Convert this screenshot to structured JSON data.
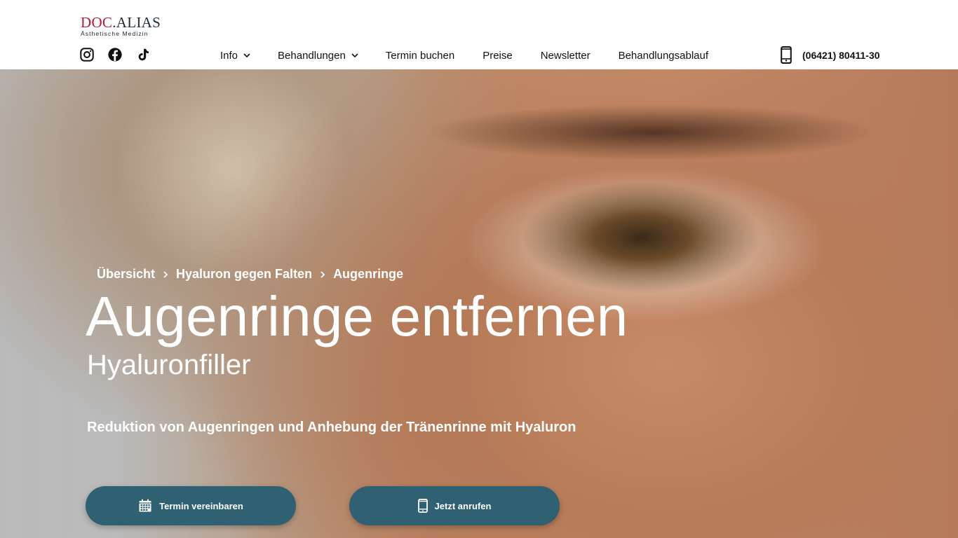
{
  "header": {
    "logo": {
      "brand_doc": "DOC",
      "brand_rest": ".ALIAS",
      "subtitle": "Ästhetische Medizin"
    },
    "social": [
      {
        "icon": "instagram-icon"
      },
      {
        "icon": "facebook-icon"
      },
      {
        "icon": "tiktok-icon"
      }
    ],
    "nav": [
      {
        "label": "Info",
        "dropdown": true
      },
      {
        "label": "Behandlungen",
        "dropdown": true
      },
      {
        "label": "Termin buchen",
        "dropdown": false
      },
      {
        "label": "Preise",
        "dropdown": false
      },
      {
        "label": "Newsletter",
        "dropdown": false
      },
      {
        "label": "Behandlungsablauf",
        "dropdown": false
      }
    ],
    "phone": "(06421) 80411-30"
  },
  "hero": {
    "breadcrumb": [
      "Übersicht",
      "Hyaluron gegen Falten",
      "Augenringe"
    ],
    "title": "Augenringe entfernen",
    "subtitle": "Hyaluronfiller",
    "lead": "Reduktion von Augenringen und Anhebung der Tränenrinne mit Hyaluron",
    "cta_primary": "Termin vereinbaren",
    "cta_secondary": "Jetzt anrufen"
  },
  "colors": {
    "button": "#2f6172",
    "brand_red": "#b01c3c",
    "brand_dark": "#1d2b3a"
  }
}
